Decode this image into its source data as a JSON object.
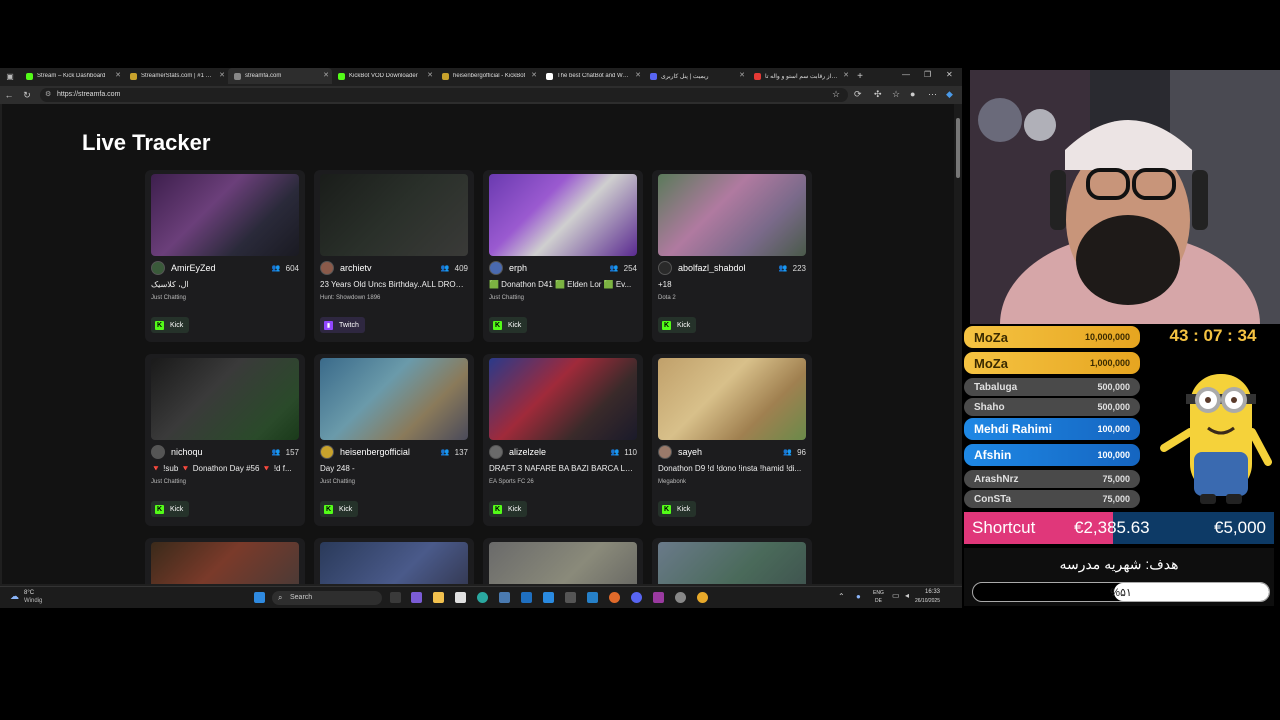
{
  "browser": {
    "tabs": [
      {
        "title": "Stream – Kick Dashboard",
        "favicon_color": "#53fc18",
        "active": false
      },
      {
        "title": "StreamerStats.com | #1 Kick",
        "favicon_color": "#c8a22c",
        "active": false
      },
      {
        "title": "streamfa.com",
        "favicon_color": "#888888",
        "active": true
      },
      {
        "title": "KickBot VOD Downloader",
        "favicon_color": "#53fc18",
        "active": false
      },
      {
        "title": "heisenbergofficial - KickBot",
        "favicon_color": "#c8a22c",
        "active": false
      },
      {
        "title": "The best ChatBot and Widg",
        "favicon_color": "#ffffff",
        "active": false
      },
      {
        "title": "ریمیت | پنل کاربری",
        "favicon_color": "#5865f2",
        "active": false
      },
      {
        "title": "از رقابت سم استو و واله تا ...",
        "favicon_color": "#e53935",
        "active": false
      }
    ],
    "url": "https://streamfa.com"
  },
  "page": {
    "title": "Live Tracker",
    "cards": [
      {
        "user": "AmirEyZed",
        "viewers": "604",
        "title": "ال، کلاسیک",
        "category": "Just Chatting",
        "platform": "Kick",
        "avatar": "#3a5a3a",
        "thumb": "linear-gradient(135deg,#3d1f4d 0%,#6b3f7a 40%,#2a2a3a 70%,#1a1a22 100%)"
      },
      {
        "user": "archietv",
        "viewers": "409",
        "title": "23 Years Old Uncs Birthday..ALL DROPS...",
        "category": "Hunt: Showdown 1896",
        "platform": "Twitch",
        "avatar": "#8a5a4a",
        "thumb": "linear-gradient(135deg,#1a1d1a 0%,#2a302a 50%,#3a3a38 100%)"
      },
      {
        "user": "erph",
        "viewers": "254",
        "title": "🟩 Donathon D41 🟩 Elden Lor 🟩 Ev...",
        "category": "Just Chatting",
        "platform": "Kick",
        "avatar": "#4a6ab0",
        "thumb": "linear-gradient(135deg,#6a3ab0 0%,#9a5ad0 35%,#cfcfcf 55%,#5a2a90 100%)"
      },
      {
        "user": "abolfazl_shabdol",
        "viewers": "223",
        "title": "+18",
        "category": "Dota 2",
        "platform": "Kick",
        "avatar": "#2a2a2a",
        "thumb": "linear-gradient(135deg,#5a7a5a 0%,#b07aa0 40%,#7a6a8a 70%,#4a5a4a 100%)"
      },
      {
        "user": "nichoqu",
        "viewers": "157",
        "title": "🔻 !sub 🔻 Donathon Day #56 🔻 !d f...",
        "category": "Just Chatting",
        "platform": "Kick",
        "avatar": "#555555",
        "thumb": "linear-gradient(135deg,#1a1a1a 0%,#3a3a3a 40%,#2a4a2a 80%,#1a3a1a 100%)"
      },
      {
        "user": "heisenbergofficial",
        "viewers": "137",
        "title": "Day 248 -",
        "category": "Just Chatting",
        "platform": "Kick",
        "avatar": "#c8a22c",
        "thumb": "linear-gradient(135deg,#3a6a8a 0%,#6a9aaa 40%,#8a7a5a 70%,#4a4a5a 100%)"
      },
      {
        "user": "alizelzele",
        "viewers": "110",
        "title": "DRAFT 3 NAFARE BA BAZI BARCA LEZZ...",
        "category": "EA Sports FC 26",
        "platform": "Kick",
        "avatar": "#6a6a6a",
        "thumb": "linear-gradient(135deg,#2a3a8a 0%,#a02a3a 40%,#3a2a2a 70%,#1a1a2a 100%)"
      },
      {
        "user": "sayeh",
        "viewers": "96",
        "title": "Donathon D9 !d !dono !insta !hamid !di...",
        "category": "Megabonk",
        "platform": "Kick",
        "avatar": "#9a7a6a",
        "thumb": "linear-gradient(135deg,#c0a06a 0%,#d8c08a 40%,#a08050 70%,#6a8a4a 100%)"
      },
      {
        "thumb": "linear-gradient(135deg,#3a2a1a 0%,#7a3a2a 40%,#3a3a3a 100%)"
      },
      {
        "thumb": "linear-gradient(135deg,#2a3a5a 0%,#4a5a8a 50%,#2a2a3a 100%)"
      },
      {
        "thumb": "linear-gradient(135deg,#6a6a6a 0%,#8a8a7a 50%,#5a5a5a 100%)"
      },
      {
        "thumb": "linear-gradient(135deg,#6a7a8a 0%,#4a6a5a 50%,#3a4a4a 100%)"
      }
    ]
  },
  "taskbar": {
    "weather_temp": "8°C",
    "weather_text": "Windig",
    "search_placeholder": "Search",
    "lang_top": "ENG",
    "lang_bottom": "DE",
    "time": "16:33",
    "date": "26/10/2025"
  },
  "overlay": {
    "timer": "43 : 07 : 34",
    "donors": [
      {
        "name": "MoZa",
        "amount": "10,000,000",
        "style": "gold"
      },
      {
        "name": "MoZa",
        "amount": "1,000,000",
        "style": "gold"
      },
      {
        "name": "Tabaluga",
        "amount": "500,000",
        "style": "grey"
      },
      {
        "name": "Shaho",
        "amount": "500,000",
        "style": "grey"
      },
      {
        "name": "Mehdi Rahimi",
        "amount": "100,000",
        "style": "blue"
      },
      {
        "name": "Afshin",
        "amount": "100,000",
        "style": "blue"
      },
      {
        "name": "ArashNrz",
        "amount": "75,000",
        "style": "grey"
      },
      {
        "name": "ConSTa",
        "amount": "75,000",
        "style": "grey"
      }
    ],
    "shortcut": {
      "label": "Shortcut",
      "current": "€2,385.63",
      "goal": "€5,000",
      "progress": 0.48
    },
    "school_goal": {
      "title": "هدف: شهریه مدرسه",
      "percent_text": "%۵۱",
      "progress": 0.51
    }
  },
  "colors": {
    "kick_green": "#53fc18",
    "twitch_purple": "#9146ff",
    "gold": "#f5c342",
    "blue": "#1e88e5",
    "pink": "#e0377a"
  }
}
